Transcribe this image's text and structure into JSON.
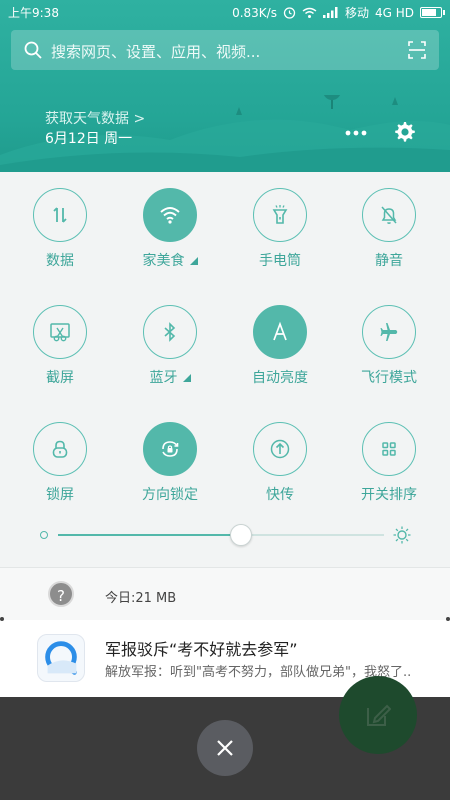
{
  "status_bar": {
    "time": "上午9:38",
    "net_speed": "0.83K/s",
    "carrier": "移动",
    "network": "4G HD",
    "battery_level": 0.8
  },
  "search": {
    "placeholder": "搜索网页、设置、应用、视频..."
  },
  "weather": {
    "link": "获取天气数据 >",
    "date": "6月12日 周一"
  },
  "toggles": [
    {
      "label": "数据",
      "icon": "data-arrows-icon",
      "on": false
    },
    {
      "label": "家美食",
      "icon": "wifi-icon",
      "on": true
    },
    {
      "label": "手电筒",
      "icon": "flashlight-icon",
      "on": false
    },
    {
      "label": "静音",
      "icon": "bell-mute-icon",
      "on": false
    },
    {
      "label": "截屏",
      "icon": "screenshot-icon",
      "on": false
    },
    {
      "label": "蓝牙",
      "icon": "bluetooth-icon",
      "on": false
    },
    {
      "label": "自动亮度",
      "icon": "auto-brightness-icon",
      "on": true
    },
    {
      "label": "飞行模式",
      "icon": "airplane-icon",
      "on": false
    },
    {
      "label": "锁屏",
      "icon": "lock-icon",
      "on": false
    },
    {
      "label": "方向锁定",
      "icon": "rotation-lock-icon",
      "on": true
    },
    {
      "label": "快传",
      "icon": "quick-transfer-icon",
      "on": false
    },
    {
      "label": "开关排序",
      "icon": "grid-sort-icon",
      "on": false
    }
  ],
  "brightness": {
    "level": 0.56
  },
  "notifications": {
    "data_usage": "今日:21 MB",
    "news": {
      "title": "军报驳斥“考不好就去参军”",
      "body": "解放军报：听到\"高考不努力，部队做兄弟\"，我怒了.."
    }
  },
  "colors": {
    "accent": "#53b8aa",
    "header": "#24a596"
  }
}
